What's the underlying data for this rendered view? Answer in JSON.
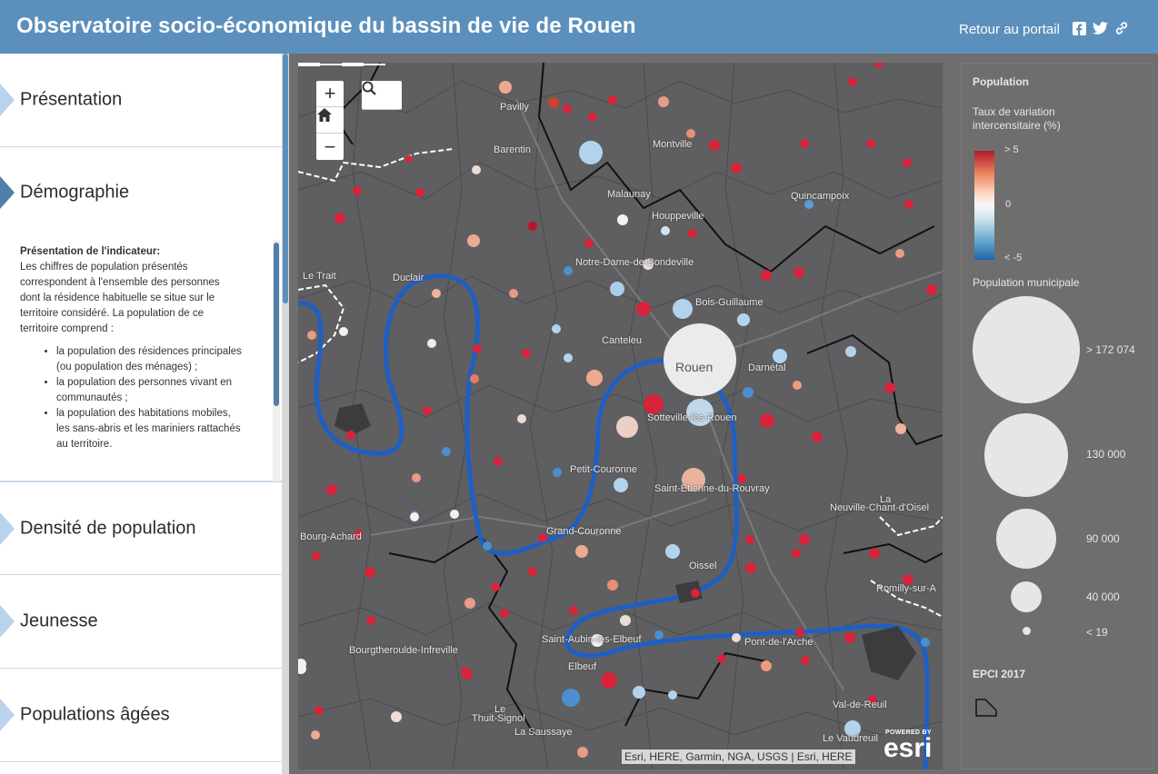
{
  "header": {
    "title": "Observatoire socio-économique du bassin de vie de Rouen",
    "portal_link": "Retour au portail",
    "icons": [
      "facebook-icon",
      "twitter-icon",
      "link-icon"
    ]
  },
  "sections": [
    {
      "label": "Présentation",
      "active": false
    },
    {
      "label": "Démographie",
      "active": true
    },
    {
      "label": "Densité de population",
      "active": false
    },
    {
      "label": "Jeunesse",
      "active": false
    },
    {
      "label": "Populations âgées",
      "active": false
    }
  ],
  "description": {
    "heading": "Présentation de l'indicateur:",
    "text": "Les chiffres de population présentés correspondent à l'ensemble des personnes dont la résidence habituelle se situe sur le territoire considéré. La population de ce territoire comprend :",
    "bullets": [
      "la population des résidences principales (ou population des ménages) ;",
      "la population des personnes vivant en communautés ;",
      "la population des habitations mobiles, les sans-abris et les mariniers rattachés au territoire."
    ]
  },
  "map": {
    "places": [
      "Pavilly",
      "Barentin",
      "Montville",
      "Malaunay",
      "Quincampoix",
      "Houppeville",
      "Notre-Dame-de-Bondeville",
      "Le Trait",
      "Duclair",
      "Bois-Guillaume",
      "Canteleu",
      "Rouen",
      "Darnétal",
      "Sotteville-lès-Rouen",
      "Petit-Couronne",
      "Saint-Étienne-du-Rouvray",
      "La",
      "Neuville-Chant-d'Oisel",
      "Bourg-Achard",
      "Grand-Couronne",
      "Oissel",
      "Romilly-sur-A",
      "Saint-Aubin-lès-Elbeuf",
      "Pont-de-l'Arche",
      "Bourgtheroulde-Infreville",
      "Elbeuf",
      "Le",
      "Thuit-Signol",
      "Val-de-Reuil",
      "La Saussaye",
      "Le Vaudreuil"
    ],
    "zoom_in": "+",
    "zoom_out": "−",
    "attribution": "Esri, HERE, Garmin, NGA, USGS | Esri, HERE",
    "esri_powered": "POWERED BY",
    "esri_logo": "esri",
    "colors": {
      "river": "#1f5fc4",
      "increase": "#d6243a",
      "decrease": "#4c8fcf",
      "neutral": "#f2f2f2"
    }
  },
  "legend": {
    "title": "Population",
    "variation_title": "Taux de variation intercensitaire (%)",
    "grad_labels": [
      "> 5",
      "0",
      "< -5"
    ],
    "size_title": "Population municipale",
    "size_labels": [
      "> 172 074",
      "130 000",
      "90 000",
      "40 000",
      "< 19"
    ],
    "epci_title": "EPCI 2017"
  }
}
